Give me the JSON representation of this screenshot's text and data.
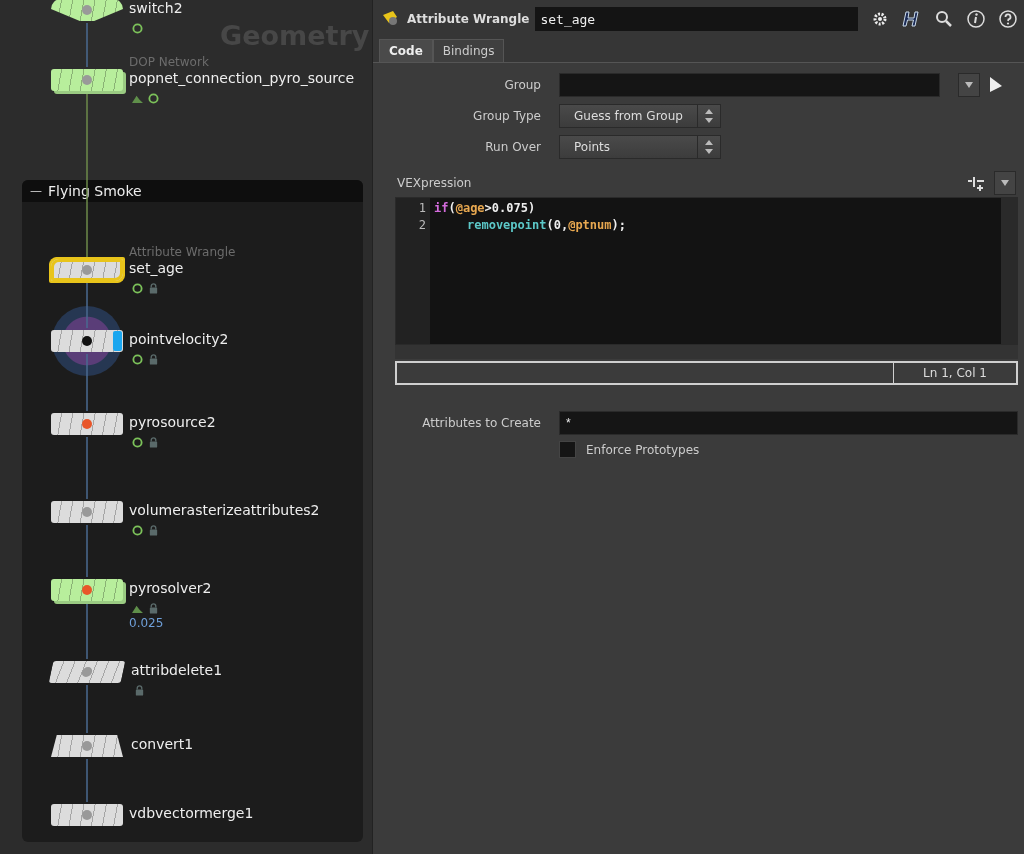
{
  "network": {
    "label": "Geometry",
    "box": {
      "title": "Flying Smoke",
      "collapse_glyph": "—"
    },
    "nodes": [
      {
        "name": "switch2",
        "kind": "switch",
        "color": "#b8ee9c",
        "selected": false,
        "display": false,
        "flags": [
          {
            "kind": "cook"
          }
        ]
      },
      {
        "name": "popnet_connection_pyro_source",
        "type": "DOP Network",
        "kind": "subnet",
        "color": "#b8ee9c",
        "selected": false,
        "display": false,
        "flags": [
          {
            "kind": "dop"
          },
          {
            "kind": "cook"
          }
        ]
      },
      {
        "name": "set_age",
        "type": "Attribute Wrangle",
        "kind": "wave",
        "color": "#dcdcdc",
        "selected": true,
        "display": false,
        "flags": [
          {
            "kind": "cook"
          },
          {
            "kind": "lock"
          }
        ]
      },
      {
        "name": "pointvelocity2",
        "kind": "plain",
        "color": "#dcdcdc",
        "selected": false,
        "display": true,
        "flags": [
          {
            "kind": "cook"
          },
          {
            "kind": "lock"
          }
        ]
      },
      {
        "name": "pyrosource2",
        "kind": "plain",
        "color": "#dcdcdc",
        "selected": false,
        "display": false,
        "flags": [
          {
            "kind": "cook"
          },
          {
            "kind": "lock"
          }
        ]
      },
      {
        "name": "volumerasterizeattributes2",
        "kind": "plain",
        "color": "#dcdcdc",
        "selected": false,
        "display": false,
        "flags": [
          {
            "kind": "cook"
          },
          {
            "kind": "lock"
          }
        ]
      },
      {
        "name": "pyrosolver2",
        "kind": "subnet",
        "color": "#b8ee9c",
        "selected": false,
        "display": false,
        "flags": [
          {
            "kind": "dop"
          },
          {
            "kind": "lock"
          }
        ],
        "note": "0.025"
      },
      {
        "name": "attribdelete1",
        "kind": "slant",
        "color": "#dcdcdc",
        "selected": false,
        "display": false,
        "flags": [
          {
            "kind": "lock"
          }
        ]
      },
      {
        "name": "convert1",
        "kind": "trapezoid",
        "color": "#dcdcdc",
        "selected": false,
        "display": false
      },
      {
        "name": "vdbvectormerge1",
        "kind": "plain",
        "color": "#dcdcdc",
        "selected": false,
        "display": false
      }
    ]
  },
  "parameters": {
    "node_type": "Attribute Wrangle",
    "node_name": "set_age",
    "tabs": [
      {
        "label": "Code",
        "selected": true
      },
      {
        "label": "Bindings",
        "selected": false
      }
    ],
    "group": {
      "label": "Group"
    },
    "group_type": {
      "label": "Group Type",
      "value": "Guess from Group"
    },
    "run_over": {
      "label": "Run Over",
      "value": "Points"
    },
    "vexpression": {
      "label": "VEXpression",
      "lines": [
        {
          "number": "1",
          "indented": false,
          "tokens": [
            {
              "kind": "keyword",
              "text": "if"
            },
            {
              "kind": "plain",
              "text": "("
            },
            {
              "kind": "attribute",
              "text": "@age"
            },
            {
              "kind": "plain",
              "text": ">0.075)"
            }
          ]
        },
        {
          "number": "2",
          "indented": true,
          "tokens": [
            {
              "kind": "function",
              "text": "removepoint"
            },
            {
              "kind": "plain",
              "text": "(0,"
            },
            {
              "kind": "attribute",
              "text": "@ptnum"
            },
            {
              "kind": "plain",
              "text": ");"
            }
          ]
        }
      ],
      "cursor": "Ln 1, Col 1"
    },
    "attributes_to_create": {
      "label": "Attributes to Create",
      "value": "*"
    },
    "enforce_prototypes": {
      "label": "Enforce Prototypes",
      "checked": false
    }
  }
}
